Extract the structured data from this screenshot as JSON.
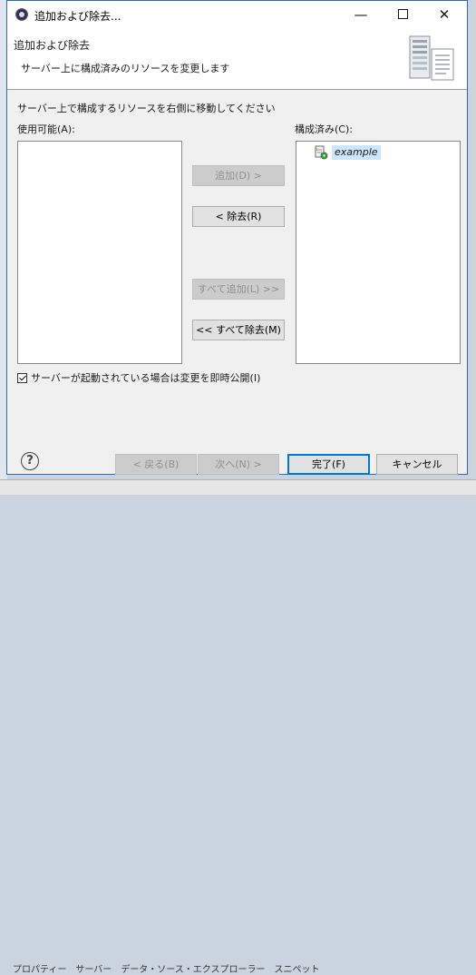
{
  "window": {
    "title": "追加および除去...",
    "min_glyph": "—",
    "close_glyph": "✕"
  },
  "header": {
    "title": "追加および除去",
    "description": "サーバー上に構成済みのリソースを変更します"
  },
  "instruction": "サーバー上で構成するリソースを右側に移動してください",
  "available": {
    "label": "使用可能(A):",
    "items": []
  },
  "configured": {
    "label": "構成済み(C):",
    "items": [
      {
        "label": "example",
        "icon": "project-resource-icon"
      }
    ]
  },
  "move_buttons": {
    "add": "追加(D) >",
    "remove": "< 除去(R)",
    "add_all": "すべて追加(L) >>",
    "remove_all": "<< すべて除去(M)"
  },
  "publish_option": {
    "label": "サーバーが起動されている場合は変更を即時公開(I)",
    "checked": true
  },
  "footer": {
    "help_glyph": "?",
    "back": "< 戻る(B)",
    "next": "次へ(N) >",
    "finish": "完了(F)",
    "cancel": "キャンセル"
  },
  "background_tabs": [
    "プロパティー",
    "サーバー",
    "データ・ソース・エクスプローラー",
    "スニペット"
  ],
  "colors": {
    "accent": "#0078d7",
    "selection": "#cce6ff",
    "dialog_border": "#2b6cb5"
  }
}
